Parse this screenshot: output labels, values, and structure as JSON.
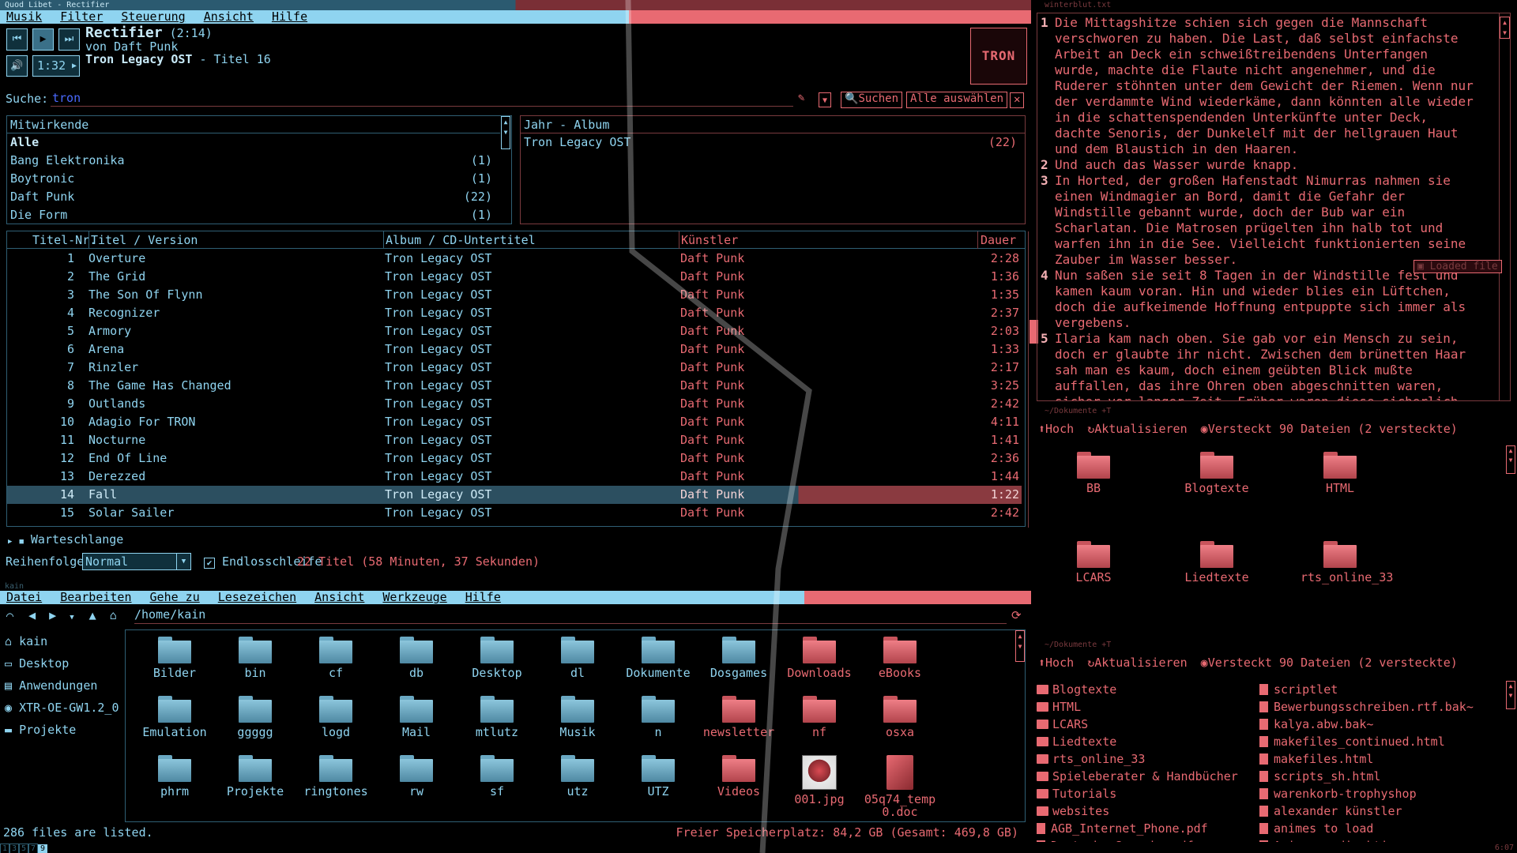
{
  "player": {
    "window_title": "Quod Libet - Rectifier",
    "menu": [
      "Musik",
      "Filter",
      "Steuerung",
      "Ansicht",
      "Hilfe"
    ],
    "track_title": "Rectifier",
    "track_length": "(2:14)",
    "by_line": "von Daft Punk",
    "album_line": "Tron Legacy OST",
    "album_suffix": " - Titel 16",
    "position": "1:32",
    "cover_text": "TRON",
    "search_label": "Suche:",
    "search_value": "tron",
    "search_button": "Suchen",
    "select_all_button": "Alle auswählen",
    "artists_header": "Mitwirkende",
    "artists": [
      {
        "name": "Alle",
        "count": ""
      },
      {
        "name": "Bang Elektronika",
        "count": "(1)"
      },
      {
        "name": "Boytronic",
        "count": "(1)"
      },
      {
        "name": "Daft Punk",
        "count": "(22)"
      },
      {
        "name": "Die Form",
        "count": "(1)"
      }
    ],
    "albums_header": "Jahr - Album",
    "albums": [
      {
        "name": "Tron Legacy OST",
        "count": "(22)"
      }
    ],
    "columns": {
      "nr": "Titel-Nr.",
      "title": "Titel / Version",
      "album": "Album / CD-Untertitel",
      "artist": "Künstler",
      "duration": "Dauer"
    },
    "tracks": [
      {
        "nr": "1",
        "title": "Overture",
        "album": "Tron Legacy OST",
        "artist": "Daft Punk",
        "duration": "2:28"
      },
      {
        "nr": "2",
        "title": "The Grid",
        "album": "Tron Legacy OST",
        "artist": "Daft Punk",
        "duration": "1:36"
      },
      {
        "nr": "3",
        "title": "The Son Of Flynn",
        "album": "Tron Legacy OST",
        "artist": "Daft Punk",
        "duration": "1:35"
      },
      {
        "nr": "4",
        "title": "Recognizer",
        "album": "Tron Legacy OST",
        "artist": "Daft Punk",
        "duration": "2:37"
      },
      {
        "nr": "5",
        "title": "Armory",
        "album": "Tron Legacy OST",
        "artist": "Daft Punk",
        "duration": "2:03"
      },
      {
        "nr": "6",
        "title": "Arena",
        "album": "Tron Legacy OST",
        "artist": "Daft Punk",
        "duration": "1:33"
      },
      {
        "nr": "7",
        "title": "Rinzler",
        "album": "Tron Legacy OST",
        "artist": "Daft Punk",
        "duration": "2:17"
      },
      {
        "nr": "8",
        "title": "The Game Has Changed",
        "album": "Tron Legacy OST",
        "artist": "Daft Punk",
        "duration": "3:25"
      },
      {
        "nr": "9",
        "title": "Outlands",
        "album": "Tron Legacy OST",
        "artist": "Daft Punk",
        "duration": "2:42"
      },
      {
        "nr": "10",
        "title": "Adagio For TRON",
        "album": "Tron Legacy OST",
        "artist": "Daft Punk",
        "duration": "4:11"
      },
      {
        "nr": "11",
        "title": "Nocturne",
        "album": "Tron Legacy OST",
        "artist": "Daft Punk",
        "duration": "1:41"
      },
      {
        "nr": "12",
        "title": "End Of Line",
        "album": "Tron Legacy OST",
        "artist": "Daft Punk",
        "duration": "2:36"
      },
      {
        "nr": "13",
        "title": "Derezzed",
        "album": "Tron Legacy OST",
        "artist": "Daft Punk",
        "duration": "1:44"
      },
      {
        "nr": "14",
        "title": "Fall",
        "album": "Tron Legacy OST",
        "artist": "Daft Punk",
        "duration": "1:22"
      },
      {
        "nr": "15",
        "title": "Solar Sailer",
        "album": "Tron Legacy OST",
        "artist": "Daft Punk",
        "duration": "2:42"
      }
    ],
    "queue_label": "Warteschlange",
    "order_label": "Reihenfolge:",
    "order_value": "Normal",
    "loop_label": "Endlosschleife",
    "summary": "22 Titel (58 Minuten, 37 Sekunden)"
  },
  "filemanager": {
    "window_title": "kain",
    "menu": [
      "Datei",
      "Bearbeiten",
      "Gehe zu",
      "Lesezeichen",
      "Ansicht",
      "Werkzeuge",
      "Hilfe"
    ],
    "path": "/home/kain",
    "places": [
      "kain",
      "Desktop",
      "Anwendungen",
      "XTR-OE-GW1.2_0",
      "Projekte"
    ],
    "items": [
      {
        "name": "Bilder",
        "color": "blue"
      },
      {
        "name": "bin",
        "color": "blue"
      },
      {
        "name": "cf",
        "color": "blue"
      },
      {
        "name": "db",
        "color": "blue"
      },
      {
        "name": "Desktop",
        "color": "blue"
      },
      {
        "name": "dl",
        "color": "blue"
      },
      {
        "name": "Dokumente",
        "color": "blue"
      },
      {
        "name": "Dosgames",
        "color": "blue"
      },
      {
        "name": "Downloads",
        "color": "red"
      },
      {
        "name": "eBooks",
        "color": "red"
      },
      {
        "name": "Emulation",
        "color": "blue"
      },
      {
        "name": "ggggg",
        "color": "blue"
      },
      {
        "name": "logd",
        "color": "blue"
      },
      {
        "name": "Mail",
        "color": "blue"
      },
      {
        "name": "mtlutz",
        "color": "blue"
      },
      {
        "name": "Musik",
        "color": "blue"
      },
      {
        "name": "n",
        "color": "blue"
      },
      {
        "name": "newsletter",
        "color": "red"
      },
      {
        "name": "nf",
        "color": "red"
      },
      {
        "name": "osxa",
        "color": "red"
      },
      {
        "name": "phrm",
        "color": "blue"
      },
      {
        "name": "Projekte",
        "color": "blue"
      },
      {
        "name": "ringtones",
        "color": "blue"
      },
      {
        "name": "rw",
        "color": "blue"
      },
      {
        "name": "sf",
        "color": "blue"
      },
      {
        "name": "utz",
        "color": "blue"
      },
      {
        "name": "UTZ",
        "color": "blue"
      },
      {
        "name": "Videos",
        "color": "red"
      },
      {
        "name": "001.jpg",
        "color": "image"
      },
      {
        "name": "05q74_temp0.doc",
        "color": "doc"
      }
    ],
    "status_left": "286 files are listed.",
    "status_right": "Freier Speicherplatz: 84,2 GB (Gesamt: 469,8 GB)"
  },
  "editor": {
    "window_title": "winterblut.txt",
    "tooltip": "Loaded file",
    "paragraphs": [
      {
        "n": "1",
        "lines": [
          "Die Mittagshitze schien sich gegen die Mannschaft",
          "verschworen zu haben. Die Last, daß selbst einfachste",
          "Arbeit an Deck ein schweißtreibendens Unterfangen",
          "wurde, machte die Flaute nicht angenehmer, und die",
          "Ruderer stöhnten unter dem Gewicht der Riemen. Wenn nur",
          "der verdammte Wind wiederkäme, dann könnten alle wieder",
          "in die schattenspendenden Unterkünfte unter Deck,",
          "dachte Senoris, der Dunkelelf mit der hellgrauen Haut",
          "und dem Blaustich in den Haaren."
        ]
      },
      {
        "n": "2",
        "lines": [
          "Und auch das Wasser wurde knapp."
        ]
      },
      {
        "n": "3",
        "lines": [
          "In Horted, der großen Hafenstadt Nimurras nahmen sie",
          "einen Windmagier an Bord, damit die Gefahr der",
          "Windstille gebannt wurde, doch der Bub war ein",
          "Scharlatan. Die Matrosen prügelten ihn halb tot und",
          "warfen ihn in die See. Vielleicht funktionierten seine",
          "Zauber im Wasser besser."
        ]
      },
      {
        "n": "4",
        "lines": [
          "Nun saßen sie seit 8 Tagen in der Windstille fest und",
          "kamen kaum voran. Hin und wieder blies ein Lüftchen,",
          "doch die aufkeimende Hoffnung entpuppte sich immer als",
          "vergebens."
        ]
      },
      {
        "n": "5",
        "lines": [
          "Ilaria kam nach oben. Sie gab vor ein Mensch zu sein,",
          "doch er glaubte ihr nicht. Zwischen dem brünetten Haar",
          "sah man es kaum, doch einem geübten Blick mußte",
          "auffallen, das ihre Ohren oben abgeschnitten waren,",
          "sicher vor langer Zeit. Früher waren diese sicherlich"
        ]
      }
    ]
  },
  "docs_icons": {
    "window_title": "~/Dokumente +T",
    "toolbar": {
      "up": "Hoch",
      "refresh": "Aktualisieren",
      "hidden": "Versteckt 90 Dateien (2 versteckte)"
    },
    "items": [
      "BB",
      "Blogtexte",
      "HTML",
      "LCARS",
      "Liedtexte",
      "rts_online_33"
    ]
  },
  "docs_list": {
    "window_title": "~/Dokumente +T",
    "toolbar": {
      "up": "Hoch",
      "refresh": "Aktualisieren",
      "hidden": "Versteckt 90 Dateien (2 versteckte)"
    },
    "folders": [
      "Blogtexte",
      "HTML",
      "LCARS",
      "Liedtexte",
      "rts_online_33",
      "Spieleberater & Handbücher",
      "Tutorials",
      "websites",
      "AGB_Internet_Phone.pdf",
      "Deutsche_Sprache.pdf"
    ],
    "files": [
      "scriptlet",
      "Bewerbungsschreiben.rtf.bak~",
      "kalya.abw.bak~",
      "makefiles_continued.html",
      "makefiles.html",
      "scripts_sh.html",
      "warenkorb-trophyshop",
      "alexander künstler",
      "animes to load",
      "Animes radioaktiv"
    ]
  },
  "taskbar": {
    "desktops": [
      "1",
      "3",
      "5",
      "7",
      "9"
    ],
    "clock": "6:07"
  },
  "colors": {
    "blue": "#8fd4f0",
    "red": "#e86a72",
    "selected_row": "#2c4f60"
  }
}
